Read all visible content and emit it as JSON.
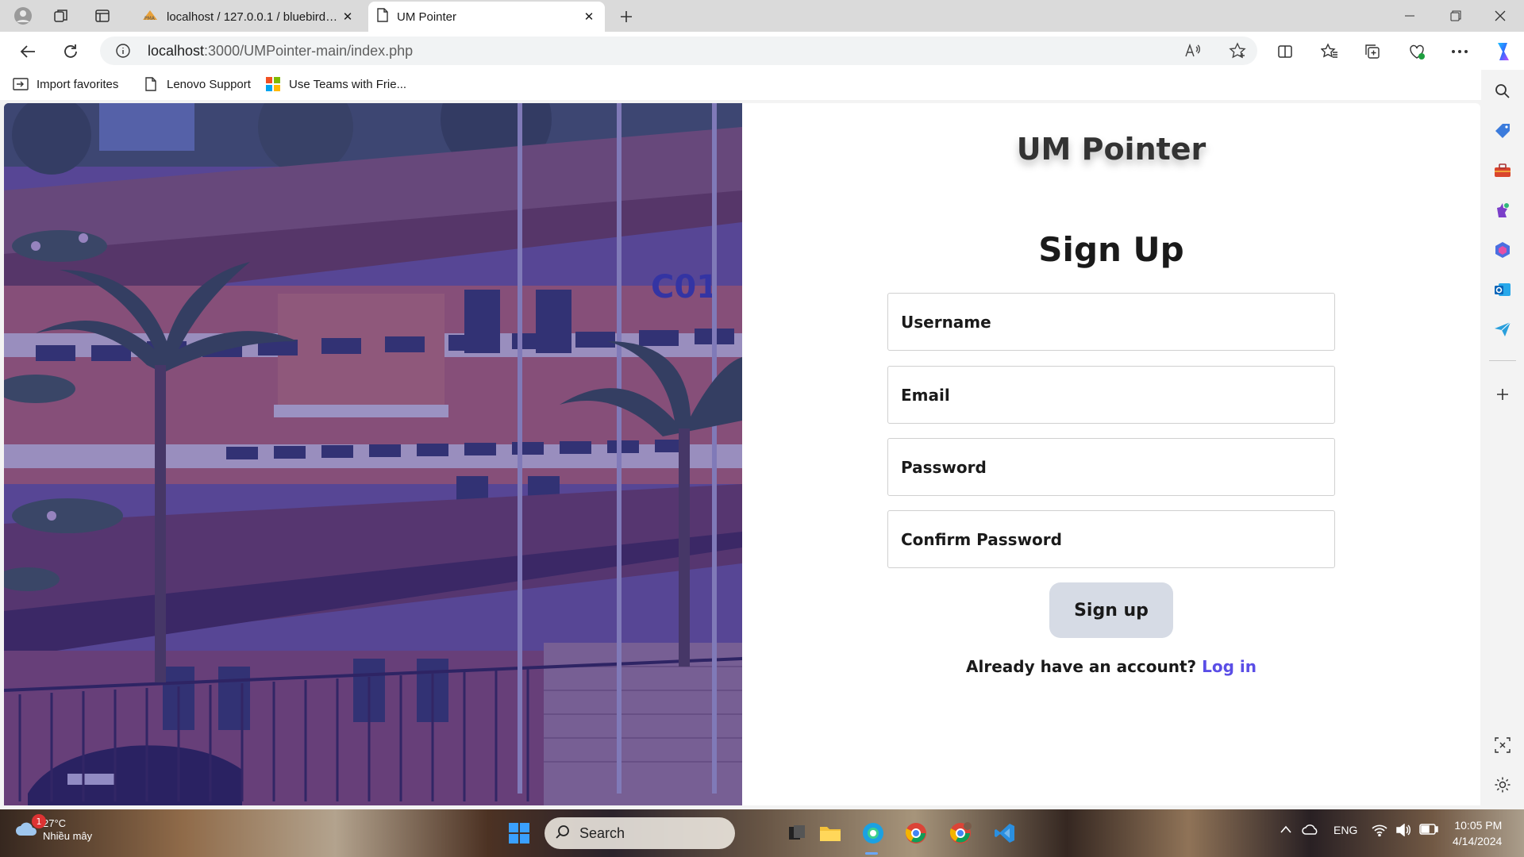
{
  "browser": {
    "tabs": [
      {
        "title": "localhost / 127.0.0.1 / bluebirdhotel",
        "icon": "phpmyadmin-icon"
      },
      {
        "title": "UM Pointer",
        "icon": "page-icon"
      }
    ],
    "address": {
      "host": "localhost",
      "path": ":3000/UMPointer-main/index.php"
    },
    "favorites": [
      {
        "label": "Import favorites",
        "icon": "import-icon"
      },
      {
        "label": "Lenovo Support",
        "icon": "page-icon"
      },
      {
        "label": "Use Teams with Frie...",
        "icon": "microsoft-icon"
      }
    ]
  },
  "page": {
    "brand": "UM Pointer",
    "heading": "Sign Up",
    "fields": {
      "username_placeholder": "Username",
      "email_placeholder": "Email",
      "password_placeholder": "Password",
      "confirm_placeholder": "Confirm Password"
    },
    "signup_label": "Sign up",
    "login_prompt": "Already have an account?",
    "login_link": "Log in",
    "photo_sign": "C01"
  },
  "taskbar": {
    "weather": {
      "temp": "27°C",
      "desc": "Nhiều mây",
      "badge": "1"
    },
    "search_placeholder": "Search",
    "lang": "ENG",
    "time": "10:05 PM",
    "date": "4/14/2024"
  },
  "colors": {
    "accent_link": "#5a4ee6",
    "button_bg": "#d6dbe5",
    "photo_tint": "#3b2fa0"
  }
}
